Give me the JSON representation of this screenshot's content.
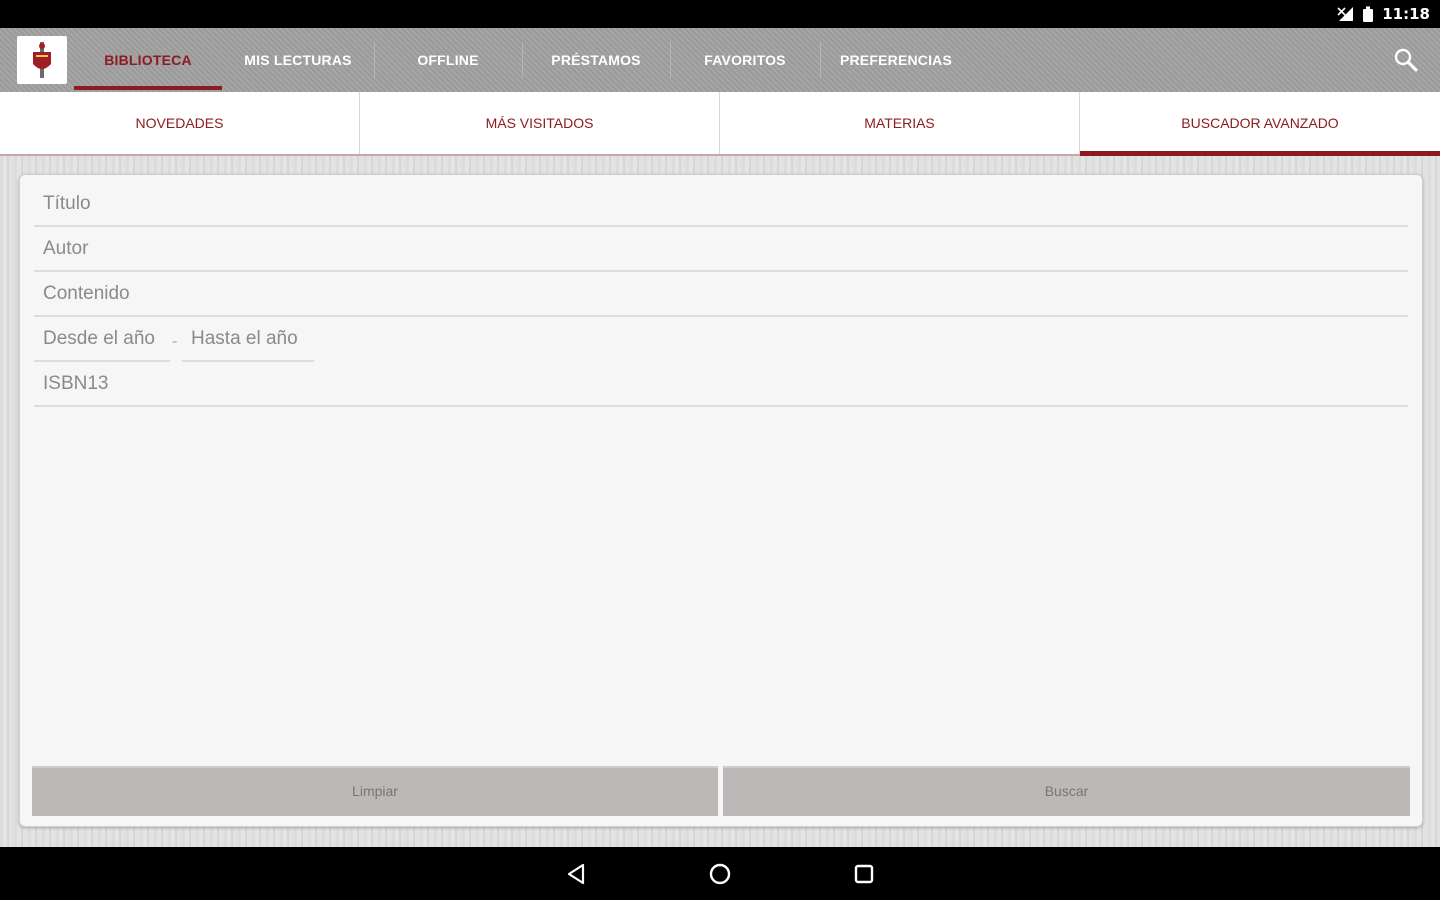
{
  "status_bar": {
    "time": "11:18"
  },
  "app": {
    "logo_icon": "crest-logo-icon",
    "main_tabs": [
      {
        "label": "BIBLIOTECA",
        "active": true
      },
      {
        "label": "MIS LECTURAS",
        "active": false
      },
      {
        "label": "OFFLINE",
        "active": false
      },
      {
        "label": "PRÉSTAMOS",
        "active": false
      },
      {
        "label": "FAVORITOS",
        "active": false
      },
      {
        "label": "PREFERENCIAS",
        "active": false
      }
    ],
    "sub_tabs": [
      {
        "label": "NOVEDADES",
        "active": false
      },
      {
        "label": "MÁS VISITADOS",
        "active": false
      },
      {
        "label": "MATERIAS",
        "active": false
      },
      {
        "label": "BUSCADOR AVANZADO",
        "active": true
      }
    ]
  },
  "form": {
    "titulo_placeholder": "Título",
    "autor_placeholder": "Autor",
    "contenido_placeholder": "Contenido",
    "desde_placeholder": "Desde el año",
    "range_separator": "-",
    "hasta_placeholder": "Hasta el año",
    "isbn_placeholder": "ISBN13",
    "limpiar_label": "Limpiar",
    "buscar_label": "Buscar"
  },
  "colors": {
    "accent": "#8b1d22",
    "toolbar": "#a0a0a0",
    "button": "#bdb8b8"
  }
}
